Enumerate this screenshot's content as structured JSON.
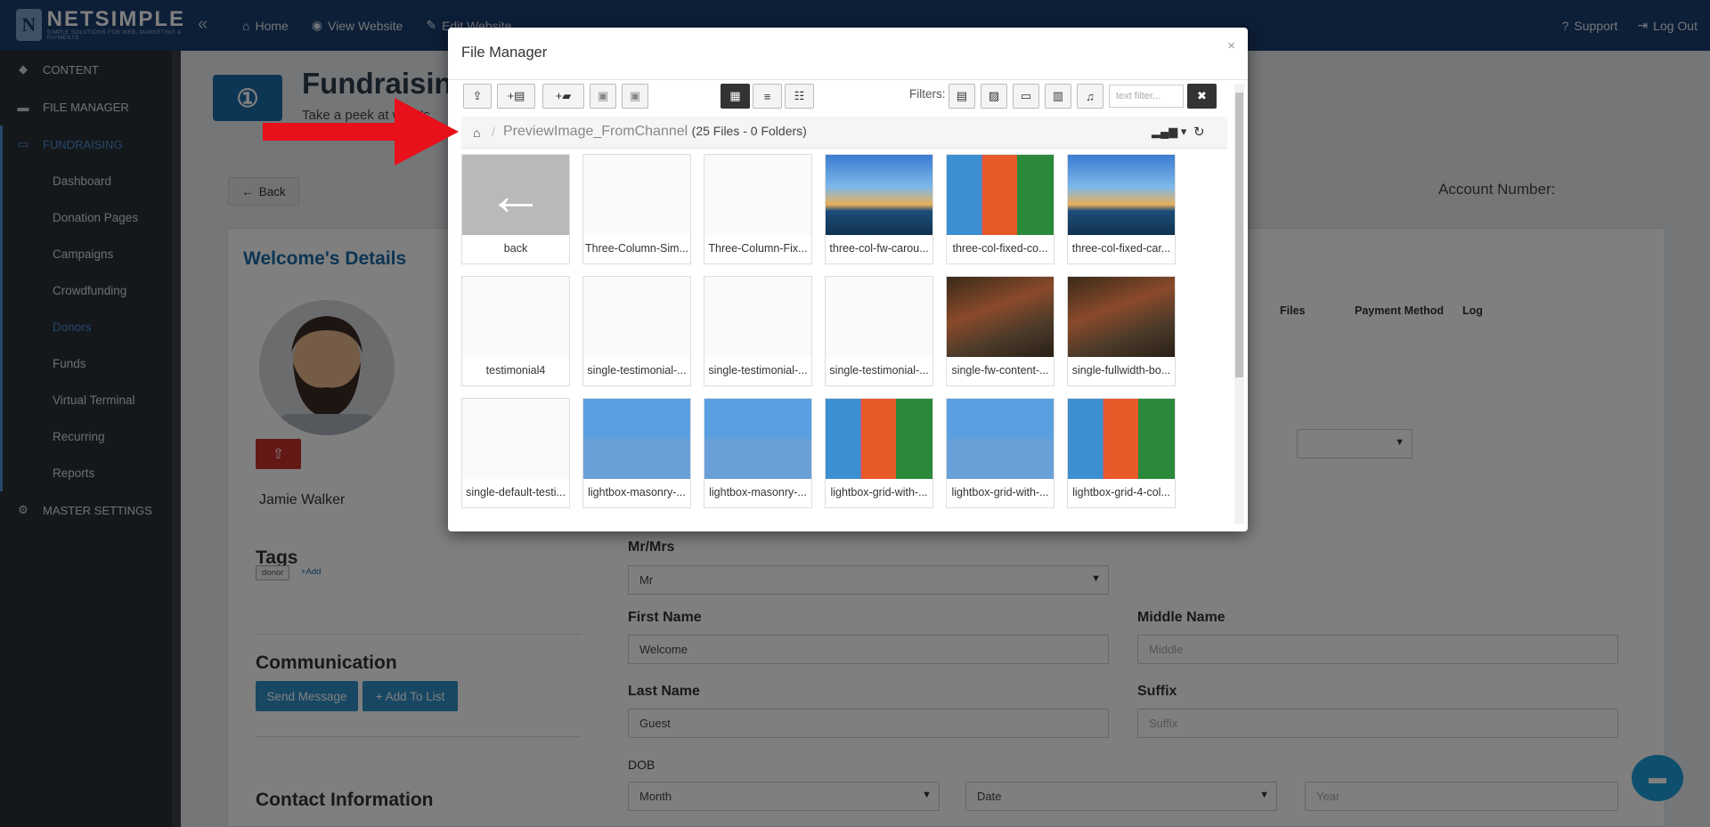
{
  "topbar": {
    "brand": "NETSIMPLE",
    "tagline": "SIMPLE SOLUTIONS FOR WEB, MARKETING & PAYMENTS",
    "nav": [
      {
        "label": "Home",
        "icon": "home-icon"
      },
      {
        "label": "View Website",
        "icon": "eye-icon"
      },
      {
        "label": "Edit Website",
        "icon": "edit-icon"
      }
    ],
    "support_label": "Support",
    "logout_label": "Log Out"
  },
  "sidebar": {
    "items": [
      {
        "label": "CONTENT",
        "icon": "diamond-icon"
      },
      {
        "label": "FILE MANAGER",
        "icon": "folder-icon"
      },
      {
        "label": "FUNDRAISING",
        "icon": "money-icon"
      },
      {
        "label": "MASTER SETTINGS",
        "icon": "gear-icon"
      }
    ],
    "subitems": [
      "Dashboard",
      "Donation Pages",
      "Campaigns",
      "Crowdfunding",
      "Donors",
      "Funds",
      "Virtual Terminal",
      "Recurring",
      "Reports"
    ],
    "active_subitem": "Donors"
  },
  "page": {
    "title": "Fundraising",
    "subtitle": "Take a peek at what's",
    "back_label": "Back",
    "account_label": "Account Number:",
    "details_title": "Welcome's Details",
    "user_name": "Jamie Walker",
    "tags_heading": "Tags",
    "tag": "donor",
    "add_tag": "+Add",
    "communication_heading": "Communication",
    "send_message": "Send Message",
    "add_to_list": "+ Add To List",
    "contact_heading": "Contact Information",
    "tabs": [
      "Files",
      "Payment Method",
      "Log"
    ],
    "form": {
      "title_label": "Mr/Mrs",
      "title_value": "Mr",
      "first_label": "First Name",
      "first_value": "Welcome",
      "middle_label": "Middle Name",
      "middle_placeholder": "Middle",
      "last_label": "Last Name",
      "last_value": "Guest",
      "suffix_label": "Suffix",
      "suffix_placeholder": "Suffix",
      "dob_label": "DOB",
      "month": "Month",
      "date": "Date",
      "year_placeholder": "Year"
    }
  },
  "file_manager": {
    "title": "File Manager",
    "filters_label": "Filters:",
    "text_filter_placeholder": "text filter...",
    "path": "PreviewImage_FromChannel",
    "count": "(25 Files - 0 Folders)",
    "files": [
      {
        "label": "back",
        "thumb": "gray"
      },
      {
        "label": "Three-Column-Sim...",
        "thumb": "white"
      },
      {
        "label": "Three-Column-Fix...",
        "thumb": "white"
      },
      {
        "label": "three-col-fw-carou...",
        "thumb": "sea"
      },
      {
        "label": "three-col-fixed-co...",
        "thumb": "mosaic"
      },
      {
        "label": "three-col-fixed-car...",
        "thumb": "sea"
      },
      {
        "label": "testimonial4",
        "thumb": "white"
      },
      {
        "label": "single-testimonial-...",
        "thumb": "white"
      },
      {
        "label": "single-testimonial-...",
        "thumb": "white"
      },
      {
        "label": "single-testimonial-...",
        "thumb": "white"
      },
      {
        "label": "single-fw-content-...",
        "thumb": "forest"
      },
      {
        "label": "single-fullwidth-bo...",
        "thumb": "forest"
      },
      {
        "label": "single-default-testi...",
        "thumb": "white"
      },
      {
        "label": "lightbox-masonry-...",
        "thumb": "mosaic2"
      },
      {
        "label": "lightbox-masonry-...",
        "thumb": "mosaic2"
      },
      {
        "label": "lightbox-grid-with-...",
        "thumb": "mosaic"
      },
      {
        "label": "lightbox-grid-with-...",
        "thumb": "mosaic2"
      },
      {
        "label": "lightbox-grid-4-col...",
        "thumb": "mosaic"
      }
    ]
  },
  "colors": {
    "topbar": "#1a3c6e",
    "sidebar": "#2b3036",
    "accent": "#4a8fd6",
    "arrow": "#e8101a"
  }
}
